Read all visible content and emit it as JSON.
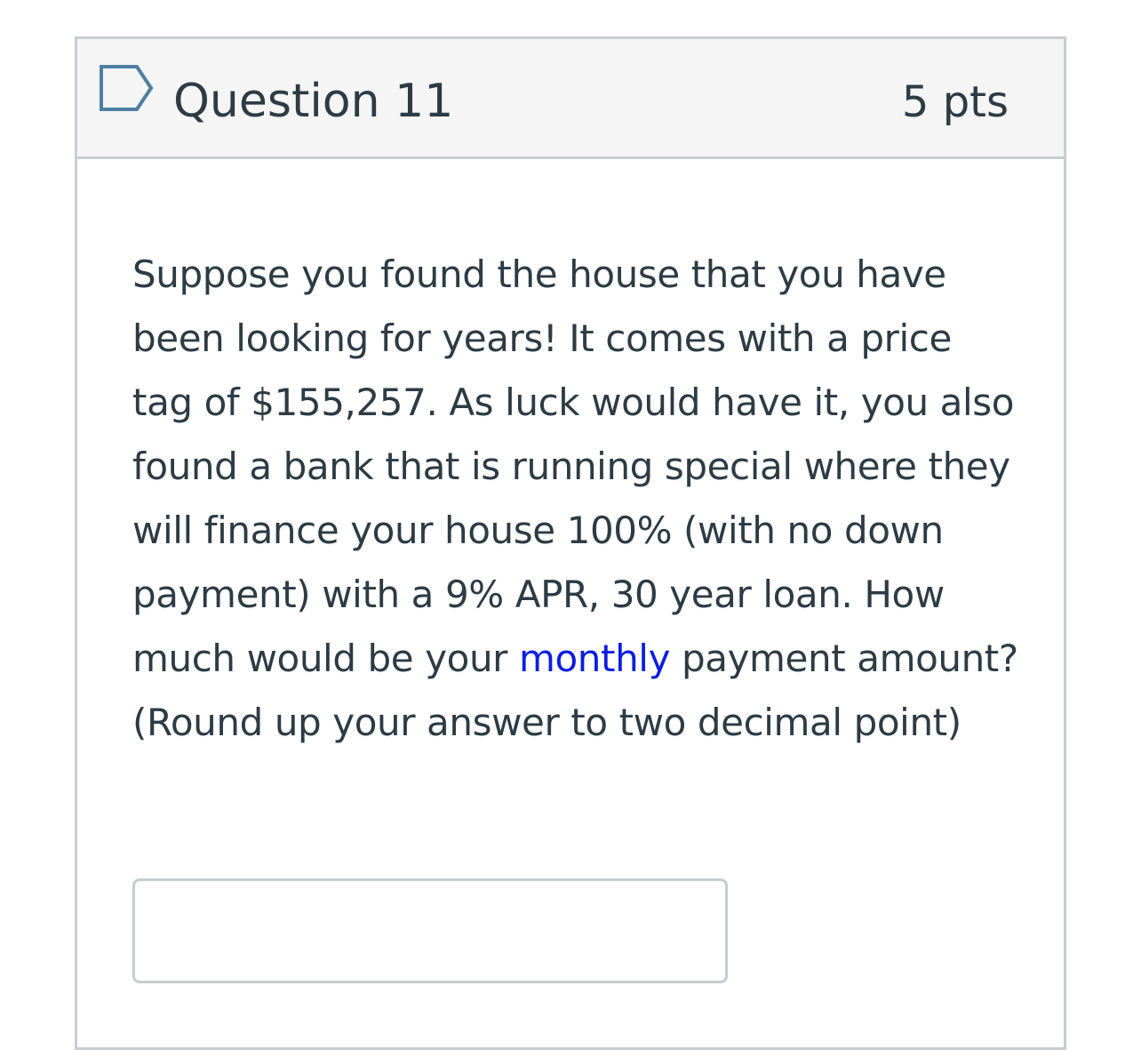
{
  "question": {
    "title": "Question 11",
    "points": "5 pts",
    "flag_icon": "bookmark-flag-icon",
    "body": {
      "text_1": "Suppose you found the house that you have been looking for years! It comes with a price tag of $155,257. As luck would have it, you also found a bank that is running special where they will finance your house 100% (with no down payment) with a 9% APR, 30 year loan. How much would be your ",
      "emphasis_1": "monthly",
      "text_2": " payment amount? (Round up your answer to ",
      "emphasis_2": "two",
      "text_3": " decimal point)"
    },
    "answer": {
      "value": "",
      "placeholder": ""
    }
  },
  "colors": {
    "header_background": "#f5f5f5",
    "border": "#c7cdd1",
    "text": "#2d3b45",
    "emphasis_blue": "#0b1ee0",
    "flag_icon": "#4f7ea1"
  }
}
